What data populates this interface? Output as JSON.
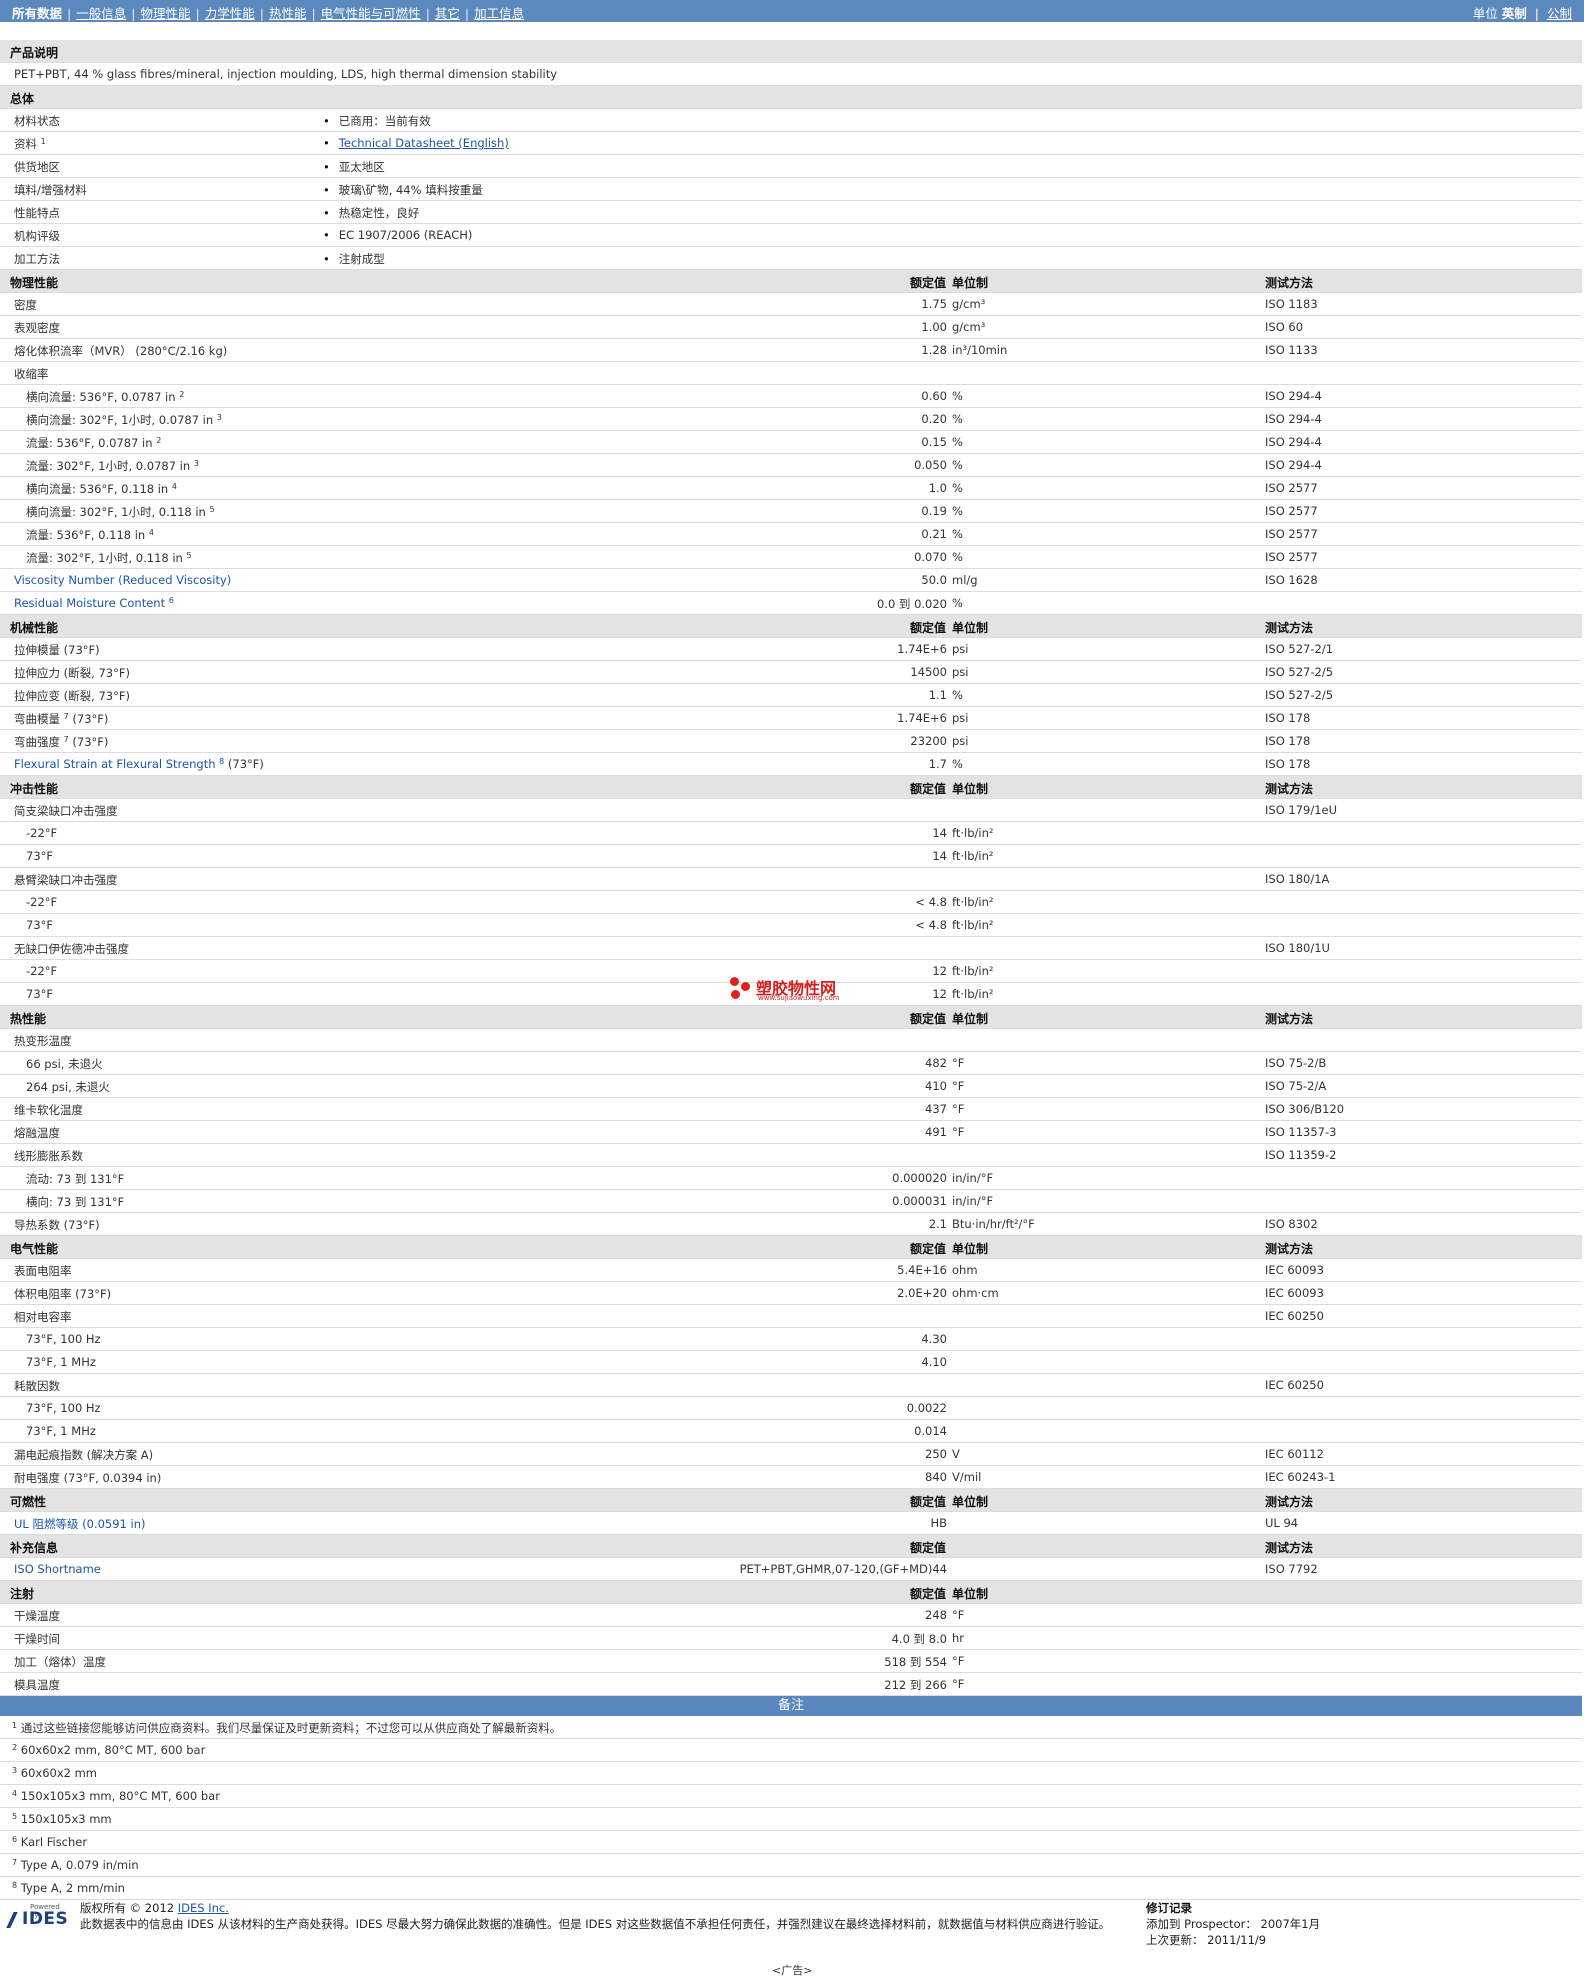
{
  "nav": {
    "items": [
      "所有数据",
      "一般信息",
      "物理性能",
      "力学性能",
      "热性能",
      "电气性能与可燃性",
      "其它",
      "加工信息"
    ],
    "unit_label": "单位",
    "unit_imperial": "英制",
    "unit_metric": "公制"
  },
  "product": {
    "section": "产品说明",
    "description": "PET+PBT, 44 % glass fibres/mineral, injection moulding, LDS, high thermal dimension stability"
  },
  "general": {
    "section": "总体",
    "rows": [
      {
        "name": "材料状态",
        "value": "已商用：当前有效"
      },
      {
        "name": "资料",
        "sup": "1",
        "value": "Technical Datasheet (English)",
        "link": true
      },
      {
        "name": "供货地区",
        "value": "亚太地区"
      },
      {
        "name": "填料/增强材料",
        "value": "玻璃\\矿物, 44% 填料按重量"
      },
      {
        "name": "性能特点",
        "value": "热稳定性，良好"
      },
      {
        "name": "机构评级",
        "value": "EC 1907/2006 (REACH)"
      },
      {
        "name": "加工方法",
        "value": "注射成型"
      }
    ]
  },
  "headers": {
    "nominal": "额定值",
    "unit": "单位制",
    "test": "测试方法"
  },
  "sections": [
    {
      "title": "物理性能",
      "rows": [
        {
          "name": "密度",
          "value": "1.75",
          "unit": "g/cm³",
          "test": "ISO 1183"
        },
        {
          "name": "表观密度",
          "value": "1.00",
          "unit": "g/cm³",
          "test": "ISO 60"
        },
        {
          "name": "熔化体积流率（MVR） (280°C/2.16 kg)",
          "value": "1.28",
          "unit": "in³/10min",
          "test": "ISO 1133"
        },
        {
          "name": "收缩率",
          "value": "",
          "unit": "",
          "test": ""
        },
        {
          "name": "横向流量: 536°F, 0.0787 in",
          "sup": "2",
          "sub": true,
          "value": "0.60",
          "unit": "%",
          "test": "ISO 294-4"
        },
        {
          "name": "横向流量: 302°F, 1小时, 0.0787 in",
          "sup": "3",
          "sub": true,
          "value": "0.20",
          "unit": "%",
          "test": "ISO 294-4"
        },
        {
          "name": "流量: 536°F, 0.0787 in",
          "sup": "2",
          "sub": true,
          "value": "0.15",
          "unit": "%",
          "test": "ISO 294-4"
        },
        {
          "name": "流量: 302°F, 1小时, 0.0787 in",
          "sup": "3",
          "sub": true,
          "value": "0.050",
          "unit": "%",
          "test": "ISO 294-4"
        },
        {
          "name": "横向流量: 536°F, 0.118 in",
          "sup": "4",
          "sub": true,
          "value": "1.0",
          "unit": "%",
          "test": "ISO 2577"
        },
        {
          "name": "横向流量: 302°F, 1小时, 0.118 in",
          "sup": "5",
          "sub": true,
          "value": "0.19",
          "unit": "%",
          "test": "ISO 2577"
        },
        {
          "name": "流量: 536°F, 0.118 in",
          "sup": "4",
          "sub": true,
          "value": "0.21",
          "unit": "%",
          "test": "ISO 2577"
        },
        {
          "name": "流量: 302°F, 1小时, 0.118 in",
          "sup": "5",
          "sub": true,
          "value": "0.070",
          "unit": "%",
          "test": "ISO 2577"
        },
        {
          "name": "Viscosity Number (Reduced Viscosity)",
          "link": true,
          "value": "50.0",
          "unit": "ml/g",
          "test": "ISO 1628"
        },
        {
          "name": "Residual Moisture Content",
          "sup": "6",
          "link": true,
          "value": "0.0 到  0.020",
          "unit": "%",
          "test": ""
        }
      ]
    },
    {
      "title": "机械性能",
      "rows": [
        {
          "name": "拉伸模量 (73°F)",
          "value": "1.74E+6",
          "unit": "psi",
          "test": "ISO 527-2/1"
        },
        {
          "name": "拉伸应力 (断裂, 73°F)",
          "value": "14500",
          "unit": "psi",
          "test": "ISO 527-2/5"
        },
        {
          "name": "拉伸应变 (断裂, 73°F)",
          "value": "1.1",
          "unit": "%",
          "test": "ISO 527-2/5"
        },
        {
          "name": "弯曲模量",
          "sup": "7",
          "tail": " (73°F)",
          "value": "1.74E+6",
          "unit": "psi",
          "test": "ISO 178"
        },
        {
          "name": "弯曲强度",
          "sup": "7",
          "tail": " (73°F)",
          "value": "23200",
          "unit": "psi",
          "test": "ISO 178"
        },
        {
          "name": "Flexural Strain at Flexural Strength",
          "sup": "8",
          "tail": " (73°F)",
          "link": true,
          "value": "1.7",
          "unit": "%",
          "test": "ISO 178"
        }
      ]
    },
    {
      "title": "冲击性能",
      "rows": [
        {
          "name": "简支梁缺口冲击强度",
          "value": "",
          "unit": "",
          "test": "ISO 179/1eU"
        },
        {
          "name": "-22°F",
          "sub": true,
          "value": "14",
          "unit": "ft·lb/in²",
          "test": ""
        },
        {
          "name": "73°F",
          "sub": true,
          "value": "14",
          "unit": "ft·lb/in²",
          "test": ""
        },
        {
          "name": "悬臂梁缺口冲击强度",
          "value": "",
          "unit": "",
          "test": "ISO 180/1A"
        },
        {
          "name": "-22°F",
          "sub": true,
          "value": "< 4.8",
          "unit": "ft·lb/in²",
          "test": ""
        },
        {
          "name": "73°F",
          "sub": true,
          "value": "< 4.8",
          "unit": "ft·lb/in²",
          "test": ""
        },
        {
          "name": "无缺口伊佐德冲击强度",
          "value": "",
          "unit": "",
          "test": "ISO 180/1U"
        },
        {
          "name": "-22°F",
          "sub": true,
          "value": "12",
          "unit": "ft·lb/in²",
          "test": ""
        },
        {
          "name": "73°F",
          "sub": true,
          "value": "12",
          "unit": "ft·lb/in²",
          "test": ""
        }
      ]
    },
    {
      "title": "热性能",
      "rows": [
        {
          "name": "热变形温度",
          "value": "",
          "unit": "",
          "test": ""
        },
        {
          "name": "66 psi, 未退火",
          "sub": true,
          "value": "482",
          "unit": "°F",
          "test": "ISO 75-2/B"
        },
        {
          "name": "264 psi, 未退火",
          "sub": true,
          "value": "410",
          "unit": "°F",
          "test": "ISO 75-2/A"
        },
        {
          "name": "维卡软化温度",
          "value": "437",
          "unit": "°F",
          "test": "ISO 306/B120"
        },
        {
          "name": "熔融温度",
          "value": "491",
          "unit": "°F",
          "test": "ISO 11357-3"
        },
        {
          "name": "线形膨胀系数",
          "value": "",
          "unit": "",
          "test": "ISO 11359-2"
        },
        {
          "name": "流动: 73 到  131°F",
          "sub": true,
          "value": "0.000020",
          "unit": "in/in/°F",
          "test": ""
        },
        {
          "name": "横向: 73 到  131°F",
          "sub": true,
          "value": "0.000031",
          "unit": "in/in/°F",
          "test": ""
        },
        {
          "name": "导热系数 (73°F)",
          "value": "2.1",
          "unit": "Btu·in/hr/ft²/°F",
          "test": "ISO 8302"
        }
      ]
    },
    {
      "title": "电气性能",
      "rows": [
        {
          "name": "表面电阻率",
          "value": "5.4E+16",
          "unit": "ohm",
          "test": "IEC 60093"
        },
        {
          "name": "体积电阻率 (73°F)",
          "value": "2.0E+20",
          "unit": "ohm·cm",
          "test": "IEC 60093"
        },
        {
          "name": "相对电容率",
          "value": "",
          "unit": "",
          "test": "IEC 60250"
        },
        {
          "name": "73°F, 100 Hz",
          "sub": true,
          "value": "4.30",
          "unit": "",
          "test": ""
        },
        {
          "name": "73°F, 1 MHz",
          "sub": true,
          "value": "4.10",
          "unit": "",
          "test": ""
        },
        {
          "name": "耗散因数",
          "value": "",
          "unit": "",
          "test": "IEC 60250"
        },
        {
          "name": "73°F, 100 Hz",
          "sub": true,
          "value": "0.0022",
          "unit": "",
          "test": ""
        },
        {
          "name": "73°F, 1 MHz",
          "sub": true,
          "value": "0.014",
          "unit": "",
          "test": ""
        },
        {
          "name": "漏电起痕指数 (解决方案 A)",
          "value": "250",
          "unit": "V",
          "test": "IEC 60112"
        },
        {
          "name": "耐电强度 (73°F, 0.0394 in)",
          "value": "840",
          "unit": "V/mil",
          "test": "IEC 60243-1"
        }
      ]
    },
    {
      "title": "可燃性",
      "rows": [
        {
          "name": "UL 阻燃等级 (0.0591 in)",
          "link": true,
          "value": "HB",
          "unit": "",
          "test": "UL 94"
        }
      ]
    },
    {
      "title": "补充信息",
      "no_unit_header": true,
      "rows": [
        {
          "name": "ISO Shortname",
          "link": true,
          "value": "PET+PBT,GHMR,07-120,(GF+MD)44",
          "unit": "",
          "test": "ISO 7792"
        }
      ]
    },
    {
      "title": "注射",
      "no_test_header": true,
      "rows": [
        {
          "name": "干燥温度",
          "value": "248",
          "unit": "°F",
          "test": ""
        },
        {
          "name": "干燥时间",
          "value": "4.0 到  8.0",
          "unit": "hr",
          "test": ""
        },
        {
          "name": "加工（熔体）温度",
          "value": "518 到  554",
          "unit": "°F",
          "test": ""
        },
        {
          "name": "模具温度",
          "value": "212 到  266",
          "unit": "°F",
          "test": ""
        }
      ]
    }
  ],
  "notes": {
    "title": "备注",
    "items": [
      {
        "n": "1",
        "text": "通过这些链接您能够访问供应商资料。我们尽量保证及时更新资料；不过您可以从供应商处了解最新资料。"
      },
      {
        "n": "2",
        "text": "60x60x2 mm, 80°C MT, 600 bar"
      },
      {
        "n": "3",
        "text": "60x60x2 mm"
      },
      {
        "n": "4",
        "text": "150x105x3 mm, 80°C MT, 600 bar"
      },
      {
        "n": "5",
        "text": "150x105x3 mm"
      },
      {
        "n": "6",
        "text": "Karl Fischer"
      },
      {
        "n": "7",
        "text": "Type A, 0.079 in/min"
      },
      {
        "n": "8",
        "text": "Type A, 2 mm/min"
      }
    ]
  },
  "footer": {
    "logo_powered": "Powered by",
    "logo_text": "IDES",
    "copyright_prefix": "版权所有 © 2012 ",
    "copyright_link": "IDES Inc.",
    "disclaimer": "此数据表中的信息由 IDES 从该材料的生产商处获得。IDES 尽最大努力确保此数据的准确性。但是 IDES 对这些数据值不承担任何责任，并强烈建议在最终选择材料前，就数据值与材料供应商进行验证。",
    "rev_title": "修订记录",
    "rev_added": "添加到 Prospector： 2007年1月",
    "rev_updated": "上次更新： 2011/11/9",
    "ad": "<广告>"
  },
  "watermark": {
    "cn": "塑胶物性网",
    "url": "www.sujiaowuxing.com"
  }
}
